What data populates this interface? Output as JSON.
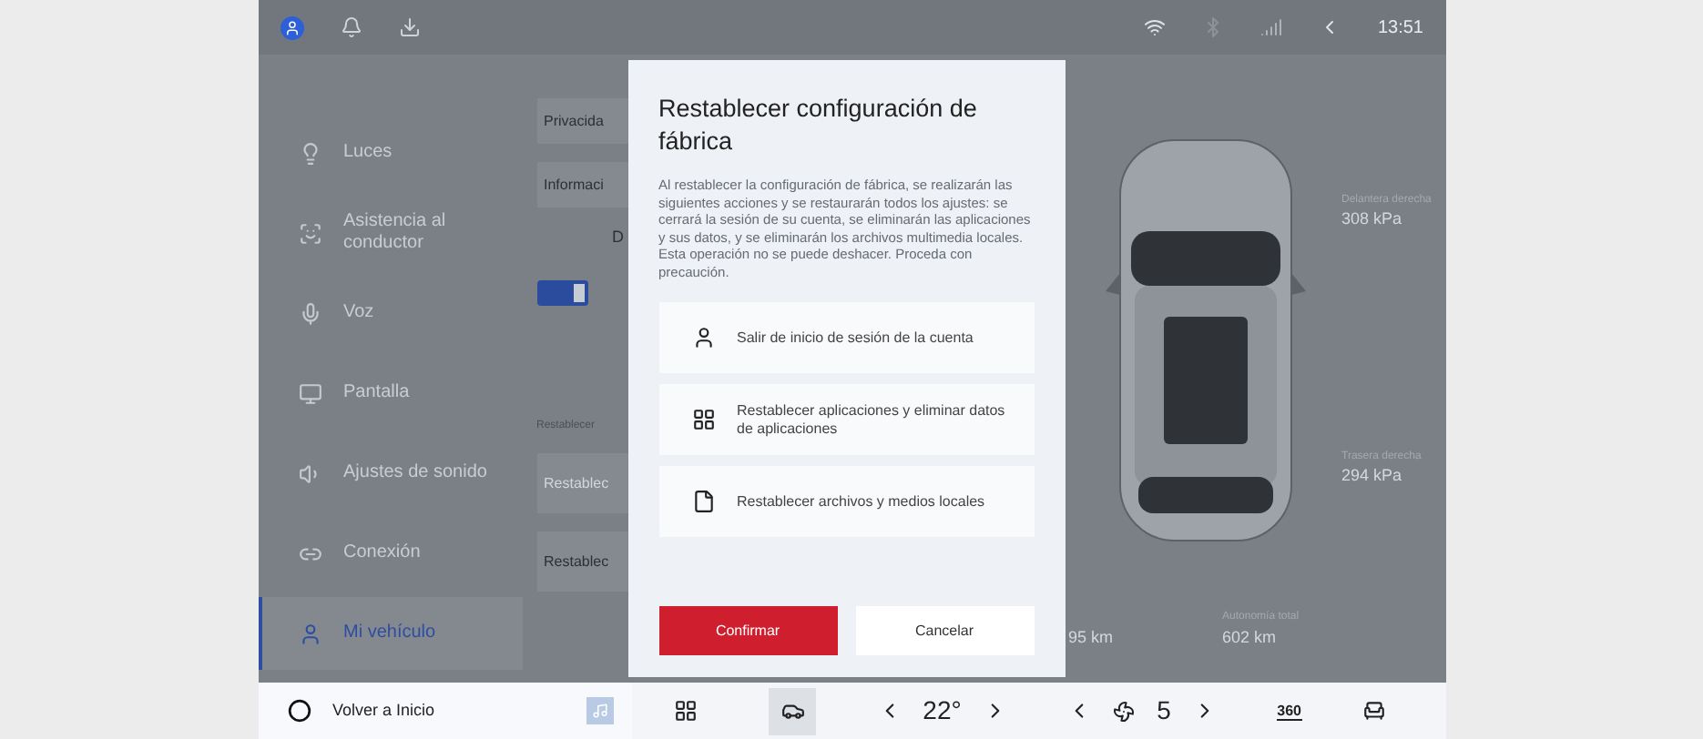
{
  "status_bar": {
    "time": "13:51"
  },
  "sidebar": {
    "items": [
      {
        "label": "Luces",
        "selected": false
      },
      {
        "label": "Asistencia al conductor",
        "selected": false
      },
      {
        "label": "Voz",
        "selected": false
      },
      {
        "label": "Pantalla",
        "selected": false
      },
      {
        "label": "Ajustes de sonido",
        "selected": false
      },
      {
        "label": "Conexión",
        "selected": false
      },
      {
        "label": "Mi vehículo",
        "selected": true
      }
    ]
  },
  "settings_panel": {
    "buttons": [
      {
        "label": "Privacida",
        "disabled": false
      },
      {
        "label": "Informaci",
        "disabled": false
      }
    ],
    "section_heading": "D",
    "toggle": {
      "on": true
    },
    "reset_label": "Restablecer",
    "reset_buttons": [
      {
        "label": "Restablec",
        "disabled": true
      },
      {
        "label": "Restablec",
        "disabled": false
      }
    ]
  },
  "dialog": {
    "title": "Restablecer configuración de fábrica",
    "message": "Al restablecer la configuración de fábrica, se realizarán las siguientes acciones y se restaurarán todos los ajustes: se cerrará la sesión de su cuenta, se eliminarán las aplicaciones y sus datos, y se eliminarán los archivos multimedia locales. Esta operación no se puede deshacer. Proceda con precaución.",
    "options": [
      {
        "kind": "account",
        "label": "Salir de inicio de sesión de la cuenta"
      },
      {
        "kind": "apps",
        "label": "Restablecer aplicaciones y eliminar datos de aplicaciones"
      },
      {
        "kind": "file",
        "label": "Restablecer archivos y medios locales"
      }
    ],
    "confirm": "Confirmar",
    "cancel": "Cancelar"
  },
  "vehicle": {
    "tires": [
      {
        "label": "Delantera derecha",
        "value": "308 kPa"
      },
      {
        "label": "Trasera derecha",
        "value": "294 kPa"
      }
    ],
    "stats": [
      {
        "value": "95 km"
      },
      {
        "label": "Autonomía total",
        "value": "602 km"
      }
    ]
  },
  "bottom_bar": {
    "home": "Volver a Inicio",
    "apps_selected": false,
    "vehicle_selected": true,
    "temperature": "22°",
    "fan_speed": "5",
    "camera_label": "360"
  }
}
